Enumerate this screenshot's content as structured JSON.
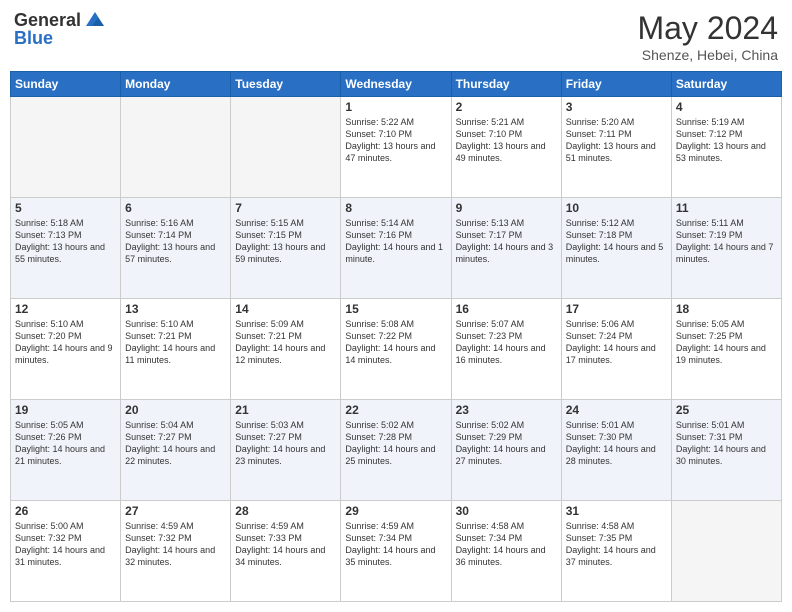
{
  "header": {
    "logo_line1": "General",
    "logo_line2": "Blue",
    "month": "May 2024",
    "location": "Shenze, Hebei, China"
  },
  "weekdays": [
    "Sunday",
    "Monday",
    "Tuesday",
    "Wednesday",
    "Thursday",
    "Friday",
    "Saturday"
  ],
  "weeks": [
    [
      {
        "day": "",
        "sunrise": "",
        "sunset": "",
        "daylight": ""
      },
      {
        "day": "",
        "sunrise": "",
        "sunset": "",
        "daylight": ""
      },
      {
        "day": "",
        "sunrise": "",
        "sunset": "",
        "daylight": ""
      },
      {
        "day": "1",
        "sunrise": "Sunrise: 5:22 AM",
        "sunset": "Sunset: 7:10 PM",
        "daylight": "Daylight: 13 hours and 47 minutes."
      },
      {
        "day": "2",
        "sunrise": "Sunrise: 5:21 AM",
        "sunset": "Sunset: 7:10 PM",
        "daylight": "Daylight: 13 hours and 49 minutes."
      },
      {
        "day": "3",
        "sunrise": "Sunrise: 5:20 AM",
        "sunset": "Sunset: 7:11 PM",
        "daylight": "Daylight: 13 hours and 51 minutes."
      },
      {
        "day": "4",
        "sunrise": "Sunrise: 5:19 AM",
        "sunset": "Sunset: 7:12 PM",
        "daylight": "Daylight: 13 hours and 53 minutes."
      }
    ],
    [
      {
        "day": "5",
        "sunrise": "Sunrise: 5:18 AM",
        "sunset": "Sunset: 7:13 PM",
        "daylight": "Daylight: 13 hours and 55 minutes."
      },
      {
        "day": "6",
        "sunrise": "Sunrise: 5:16 AM",
        "sunset": "Sunset: 7:14 PM",
        "daylight": "Daylight: 13 hours and 57 minutes."
      },
      {
        "day": "7",
        "sunrise": "Sunrise: 5:15 AM",
        "sunset": "Sunset: 7:15 PM",
        "daylight": "Daylight: 13 hours and 59 minutes."
      },
      {
        "day": "8",
        "sunrise": "Sunrise: 5:14 AM",
        "sunset": "Sunset: 7:16 PM",
        "daylight": "Daylight: 14 hours and 1 minute."
      },
      {
        "day": "9",
        "sunrise": "Sunrise: 5:13 AM",
        "sunset": "Sunset: 7:17 PM",
        "daylight": "Daylight: 14 hours and 3 minutes."
      },
      {
        "day": "10",
        "sunrise": "Sunrise: 5:12 AM",
        "sunset": "Sunset: 7:18 PM",
        "daylight": "Daylight: 14 hours and 5 minutes."
      },
      {
        "day": "11",
        "sunrise": "Sunrise: 5:11 AM",
        "sunset": "Sunset: 7:19 PM",
        "daylight": "Daylight: 14 hours and 7 minutes."
      }
    ],
    [
      {
        "day": "12",
        "sunrise": "Sunrise: 5:10 AM",
        "sunset": "Sunset: 7:20 PM",
        "daylight": "Daylight: 14 hours and 9 minutes."
      },
      {
        "day": "13",
        "sunrise": "Sunrise: 5:10 AM",
        "sunset": "Sunset: 7:21 PM",
        "daylight": "Daylight: 14 hours and 11 minutes."
      },
      {
        "day": "14",
        "sunrise": "Sunrise: 5:09 AM",
        "sunset": "Sunset: 7:21 PM",
        "daylight": "Daylight: 14 hours and 12 minutes."
      },
      {
        "day": "15",
        "sunrise": "Sunrise: 5:08 AM",
        "sunset": "Sunset: 7:22 PM",
        "daylight": "Daylight: 14 hours and 14 minutes."
      },
      {
        "day": "16",
        "sunrise": "Sunrise: 5:07 AM",
        "sunset": "Sunset: 7:23 PM",
        "daylight": "Daylight: 14 hours and 16 minutes."
      },
      {
        "day": "17",
        "sunrise": "Sunrise: 5:06 AM",
        "sunset": "Sunset: 7:24 PM",
        "daylight": "Daylight: 14 hours and 17 minutes."
      },
      {
        "day": "18",
        "sunrise": "Sunrise: 5:05 AM",
        "sunset": "Sunset: 7:25 PM",
        "daylight": "Daylight: 14 hours and 19 minutes."
      }
    ],
    [
      {
        "day": "19",
        "sunrise": "Sunrise: 5:05 AM",
        "sunset": "Sunset: 7:26 PM",
        "daylight": "Daylight: 14 hours and 21 minutes."
      },
      {
        "day": "20",
        "sunrise": "Sunrise: 5:04 AM",
        "sunset": "Sunset: 7:27 PM",
        "daylight": "Daylight: 14 hours and 22 minutes."
      },
      {
        "day": "21",
        "sunrise": "Sunrise: 5:03 AM",
        "sunset": "Sunset: 7:27 PM",
        "daylight": "Daylight: 14 hours and 23 minutes."
      },
      {
        "day": "22",
        "sunrise": "Sunrise: 5:02 AM",
        "sunset": "Sunset: 7:28 PM",
        "daylight": "Daylight: 14 hours and 25 minutes."
      },
      {
        "day": "23",
        "sunrise": "Sunrise: 5:02 AM",
        "sunset": "Sunset: 7:29 PM",
        "daylight": "Daylight: 14 hours and 27 minutes."
      },
      {
        "day": "24",
        "sunrise": "Sunrise: 5:01 AM",
        "sunset": "Sunset: 7:30 PM",
        "daylight": "Daylight: 14 hours and 28 minutes."
      },
      {
        "day": "25",
        "sunrise": "Sunrise: 5:01 AM",
        "sunset": "Sunset: 7:31 PM",
        "daylight": "Daylight: 14 hours and 30 minutes."
      }
    ],
    [
      {
        "day": "26",
        "sunrise": "Sunrise: 5:00 AM",
        "sunset": "Sunset: 7:32 PM",
        "daylight": "Daylight: 14 hours and 31 minutes."
      },
      {
        "day": "27",
        "sunrise": "Sunrise: 4:59 AM",
        "sunset": "Sunset: 7:32 PM",
        "daylight": "Daylight: 14 hours and 32 minutes."
      },
      {
        "day": "28",
        "sunrise": "Sunrise: 4:59 AM",
        "sunset": "Sunset: 7:33 PM",
        "daylight": "Daylight: 14 hours and 34 minutes."
      },
      {
        "day": "29",
        "sunrise": "Sunrise: 4:59 AM",
        "sunset": "Sunset: 7:34 PM",
        "daylight": "Daylight: 14 hours and 35 minutes."
      },
      {
        "day": "30",
        "sunrise": "Sunrise: 4:58 AM",
        "sunset": "Sunset: 7:34 PM",
        "daylight": "Daylight: 14 hours and 36 minutes."
      },
      {
        "day": "31",
        "sunrise": "Sunrise: 4:58 AM",
        "sunset": "Sunset: 7:35 PM",
        "daylight": "Daylight: 14 hours and 37 minutes."
      },
      {
        "day": "",
        "sunrise": "",
        "sunset": "",
        "daylight": ""
      }
    ]
  ]
}
